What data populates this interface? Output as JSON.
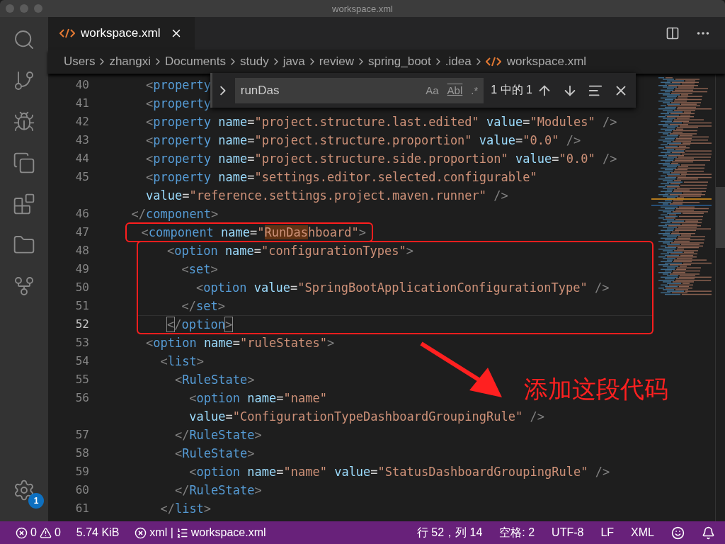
{
  "window": {
    "title": "workspace.xml"
  },
  "tabs": [
    {
      "label": "workspace.xml",
      "selected": true
    }
  ],
  "breadcrumbs": [
    "Users",
    "zhangxi",
    "Documents",
    "study",
    "java",
    "review",
    "spring_boot",
    ".idea",
    "workspace.xml"
  ],
  "find_widget": {
    "value": "runDas",
    "toggles": [
      {
        "label": "Aa",
        "on": false
      },
      {
        "label": "Abl",
        "on": false
      },
      {
        "label": ".*",
        "on": false
      }
    ],
    "count": "1 中的 1"
  },
  "editor": {
    "blocks": [
      {
        "kind": "line",
        "number": "40",
        "current": false,
        "bracket_match": false,
        "segments": [
          {
            "text": "    <property"
          }
        ]
      },
      {
        "kind": "line",
        "number": "41",
        "current": false,
        "bracket_match": false,
        "segments": [
          {
            "text": "    <property"
          }
        ]
      },
      {
        "kind": "line",
        "number": "42",
        "current": false,
        "bracket_match": false,
        "segments": [
          {
            "text": "    <property name=\"project.structure.last.edited\" value=\"Modules\" />"
          }
        ]
      },
      {
        "kind": "line",
        "number": "43",
        "current": false,
        "bracket_match": false,
        "segments": [
          {
            "text": "    <property name=\"project.structure.proportion\" value=\"0.0\" />"
          }
        ]
      },
      {
        "kind": "line",
        "number": "44",
        "current": false,
        "bracket_match": false,
        "segments": [
          {
            "text": "    <property name=\"project.structure.side.proportion\" value=\"0.0\" />"
          }
        ]
      },
      {
        "kind": "line",
        "number": "45",
        "current": false,
        "bracket_match": false,
        "segments": [
          {
            "text": "    <property name=\"settings.editor.selected.configurable\""
          }
        ]
      },
      {
        "kind": "line",
        "current": false,
        "bracket_match": false,
        "segments": [
          {
            "text": "    value=\"reference.settings.project.maven.runner\" />"
          }
        ]
      },
      {
        "kind": "line",
        "number": "46",
        "current": false,
        "bracket_match": false,
        "segments": [
          {
            "text": "  </component>"
          }
        ]
      },
      {
        "kind": "annotation_box",
        "lines": [
          {
            "number": "47",
            "current": false,
            "bracket_match": false,
            "segments": [
              {
                "text": "  <component name=\""
              },
              {
                "text": "RunDas",
                "match": true
              },
              {
                "text": "hboard\">"
              }
            ]
          }
        ]
      },
      {
        "kind": "annotation_box",
        "lines": [
          {
            "number": "48",
            "current": false,
            "bracket_match": false,
            "segments": [
              {
                "text": "    <option name=\"configurationTypes\">"
              }
            ]
          },
          {
            "number": "49",
            "current": false,
            "bracket_match": false,
            "segments": [
              {
                "text": "      <set>"
              }
            ]
          },
          {
            "number": "50",
            "current": false,
            "bracket_match": false,
            "segments": [
              {
                "text": "        <option value=\"SpringBootApplicationConfigurationType\" />"
              }
            ]
          },
          {
            "number": "51",
            "current": false,
            "bracket_match": false,
            "segments": [
              {
                "text": "      </set>"
              }
            ]
          },
          {
            "number": "52",
            "current": true,
            "bracket_match": true,
            "segments": [
              {
                "text": "    </option>"
              }
            ]
          }
        ]
      },
      {
        "kind": "line",
        "number": "53",
        "current": false,
        "bracket_match": false,
        "segments": [
          {
            "text": "    <option name=\"ruleStates\">"
          }
        ]
      },
      {
        "kind": "line",
        "number": "54",
        "current": false,
        "bracket_match": false,
        "segments": [
          {
            "text": "      <list>"
          }
        ]
      },
      {
        "kind": "line",
        "number": "55",
        "current": false,
        "bracket_match": false,
        "segments": [
          {
            "text": "        <RuleState>"
          }
        ]
      },
      {
        "kind": "line",
        "number": "56",
        "current": false,
        "bracket_match": false,
        "segments": [
          {
            "text": "          <option name=\"name\""
          }
        ]
      },
      {
        "kind": "line",
        "current": false,
        "bracket_match": false,
        "segments": [
          {
            "text": "          value=\"ConfigurationTypeDashboardGroupingRule\" />"
          }
        ]
      },
      {
        "kind": "line",
        "number": "57",
        "current": false,
        "bracket_match": false,
        "segments": [
          {
            "text": "        </RuleState>"
          }
        ]
      },
      {
        "kind": "line",
        "number": "58",
        "current": false,
        "bracket_match": false,
        "segments": [
          {
            "text": "        <RuleState>"
          }
        ]
      },
      {
        "kind": "line",
        "number": "59",
        "current": false,
        "bracket_match": false,
        "segments": [
          {
            "text": "          <option name=\"name\" value=\"StatusDashboardGroupingRule\" />"
          }
        ]
      },
      {
        "kind": "line",
        "number": "60",
        "current": false,
        "bracket_match": false,
        "segments": [
          {
            "text": "        </RuleState>"
          }
        ]
      },
      {
        "kind": "line",
        "number": "61",
        "current": false,
        "bracket_match": false,
        "segments": [
          {
            "text": "      </list>"
          }
        ]
      }
    ]
  },
  "annotation": {
    "note": "添加这段代码"
  },
  "activity_bar": {
    "badge": "1"
  },
  "status_bar": {
    "errors": "0",
    "warnings": "0",
    "size": "5.74 KiB",
    "language_mode": "xml |",
    "file": "workspace.xml",
    "right": [
      "行 52，列 14",
      "空格: 2",
      "UTF-8",
      "LF",
      "XML"
    ]
  }
}
